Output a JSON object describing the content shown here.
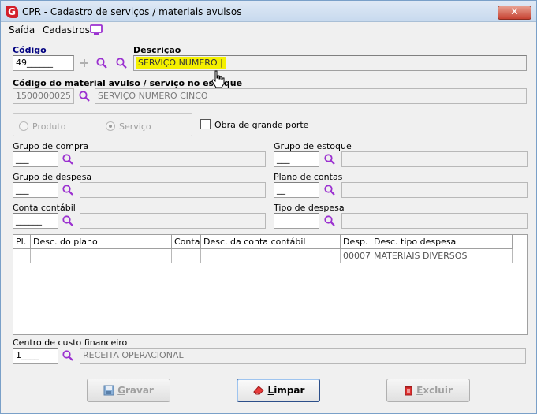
{
  "window": {
    "title": "CPR - Cadastro de serviços / materiais avulsos",
    "app_icon_letter": "G",
    "close_glyph": "✕"
  },
  "menu": {
    "items": [
      {
        "label": "Saída"
      },
      {
        "label": "Cadastros"
      }
    ],
    "monitor_icon": "monitor-icon"
  },
  "form": {
    "codigo_label": "Código",
    "codigo_value": "49______",
    "descricao_label": "Descrição",
    "descricao_value": "SERVIÇO NUMERO |",
    "estoque_label": "Código do material avulso / serviço no estoque",
    "estoque_code": "1500000025",
    "estoque_desc": "SERVIÇO NUMERO CINCO",
    "radio_produto": "Produto",
    "radio_servico": "Serviço",
    "obra_label": "Obra de grande porte",
    "grupo_compra_label": "Grupo de compra",
    "grupo_compra_value": "___",
    "grupo_estoque_label": "Grupo de estoque",
    "grupo_estoque_value": "___",
    "grupo_despesa_label": "Grupo de despesa",
    "grupo_despesa_value": "___",
    "plano_contas_label": "Plano de contas",
    "plano_contas_value": "__",
    "conta_contabil_label": "Conta contábil",
    "conta_contabil_value": "______",
    "tipo_despesa_label": "Tipo de despesa",
    "tipo_despesa_value": "",
    "centro_custo_label": "Centro de custo financeiro",
    "centro_custo_code": "1____",
    "centro_custo_desc": "RECEITA OPERACIONAL"
  },
  "grid": {
    "headers": [
      "Pl.",
      "Desc. do plano",
      "Conta",
      "Desc. da conta contábil",
      "Desp.",
      "Desc. tipo despesa"
    ],
    "rows": [
      [
        "",
        "",
        "",
        "",
        "00007",
        "MATERIAIS DIVERSOS"
      ]
    ]
  },
  "buttons": {
    "gravar_first": "G",
    "gravar_rest": "ravar",
    "limpar_first": "L",
    "limpar_rest": "impar",
    "excluir_first": "E",
    "excluir_rest": "xcluir"
  },
  "colors": {
    "accent_purple": "#9b30d0",
    "highlight_yellow": "#f4f000",
    "title_blue": "#000080",
    "close_red": "#c74232"
  }
}
